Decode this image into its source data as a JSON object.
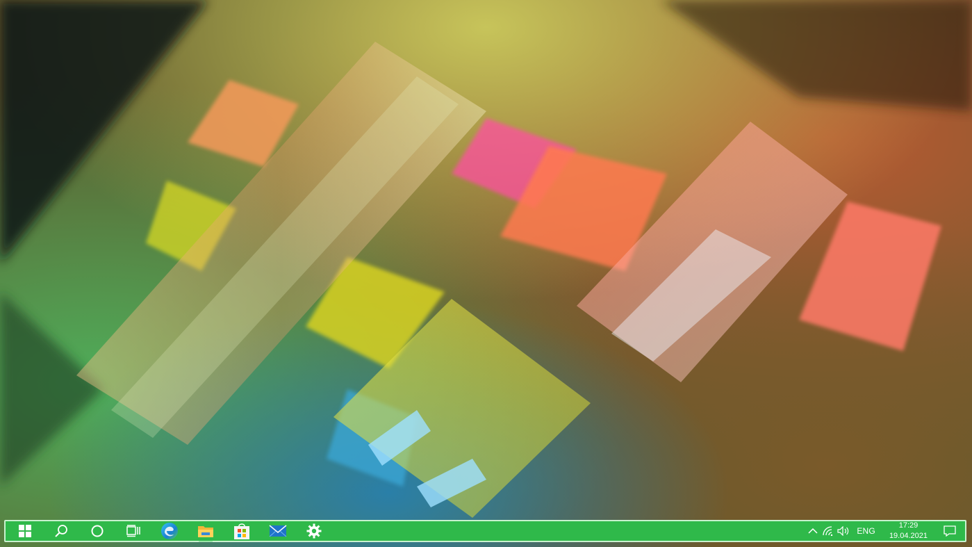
{
  "desktop": {
    "wallpaper": "colorful glass prisms casting rainbow light on textured wall"
  },
  "taskbar": {
    "background_color": "#2fb94a",
    "border_color": "#c9f2cf",
    "pinned": [
      {
        "name": "start-button",
        "icon": "windows-logo-icon"
      },
      {
        "name": "search-button",
        "icon": "search-icon"
      },
      {
        "name": "cortana-button",
        "icon": "circle-icon"
      },
      {
        "name": "task-view-button",
        "icon": "task-view-icon"
      },
      {
        "name": "edge-button",
        "icon": "edge-browser-icon"
      },
      {
        "name": "file-explorer-button",
        "icon": "folder-icon"
      },
      {
        "name": "store-button",
        "icon": "store-bag-icon"
      },
      {
        "name": "mail-button",
        "icon": "mail-envelope-icon"
      },
      {
        "name": "settings-button",
        "icon": "gear-icon"
      }
    ],
    "tray": {
      "overflow_icon": "chevron-up-icon",
      "network_icon": "wifi-icon",
      "volume_icon": "speaker-icon",
      "language": "ENG",
      "time": "17:29",
      "date": "19.04.2021",
      "notification_icon": "action-center-icon"
    }
  }
}
